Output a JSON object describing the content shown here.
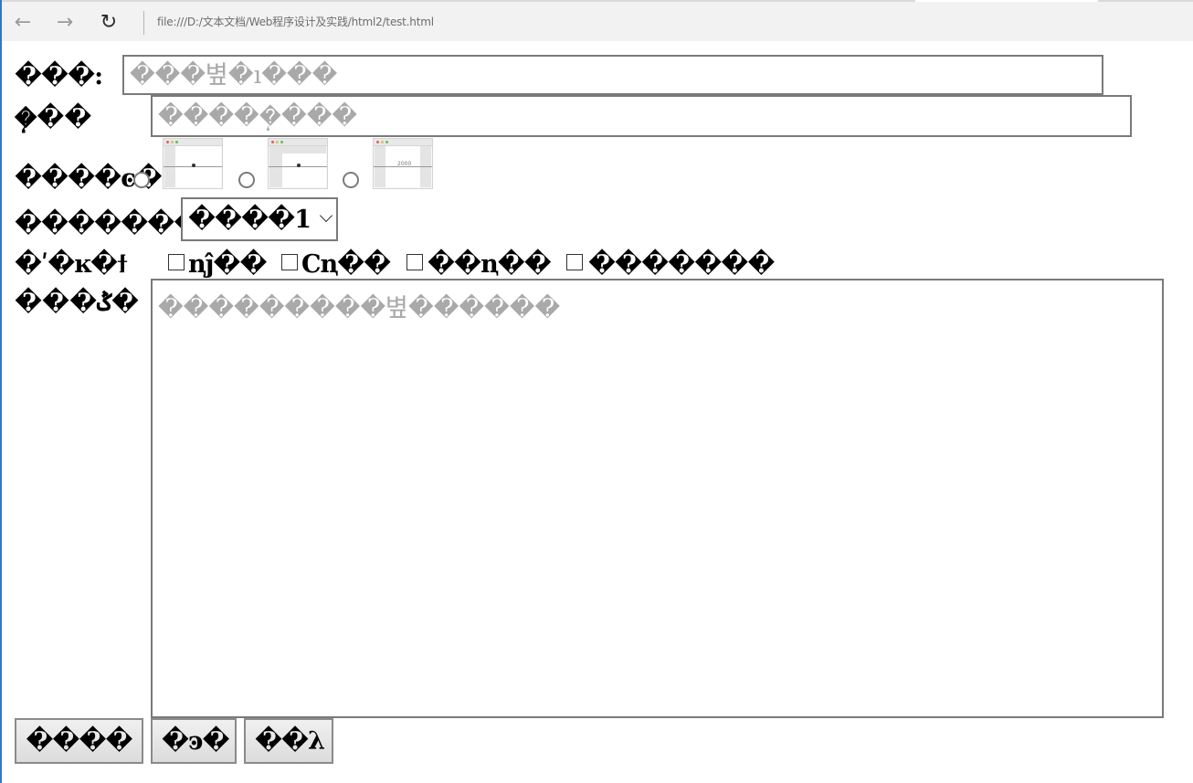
{
  "browser": {
    "address": "file:///D:/文本文档/Web程序设计及实践/html2/test.html",
    "back_icon": "←",
    "forward_icon": "→",
    "refresh_icon": "↻"
  },
  "form": {
    "name_label": "���:",
    "name_placeholder": "���볖�ı���",
    "password_label": "�ܴ��",
    "password_placeholder": "�����ܴ���",
    "image_label": "����ͼ�",
    "thumb3_text": "2000",
    "select_label": "�������",
    "select_value": "����1",
    "checkbox_label": "�ʹ�ĸ�ϯ",
    "checkbox_options": [
      "ꞑĵ��",
      "Cꞑ��",
      "��ꞑ��",
      "�������"
    ],
    "textarea_label": "���ݣ�",
    "textarea_placeholder": "���������볖������",
    "buttons": {
      "submit": "����",
      "reset": "�ͽ�",
      "cancel": "��λ"
    }
  }
}
